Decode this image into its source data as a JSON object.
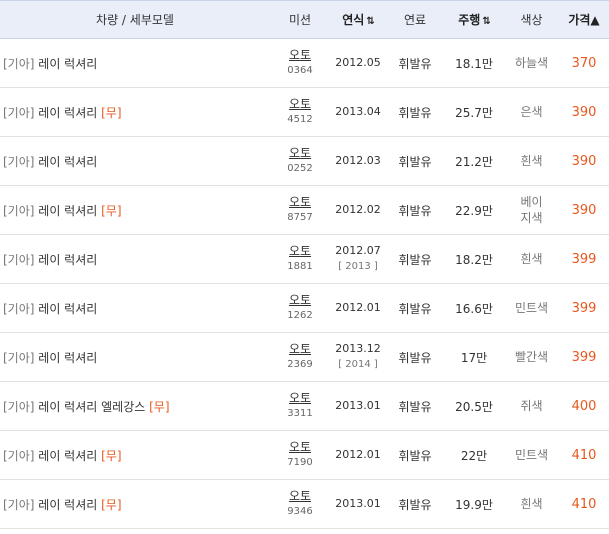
{
  "header": {
    "model": "차량 / 세부모델",
    "mission": "미션",
    "year": "연식",
    "fuel": "연료",
    "mileage": "주행",
    "color": "색상",
    "price": "가격▲",
    "sort_icon": "⇅"
  },
  "rows": [
    {
      "brand": "[기아]",
      "model": "레이 럭셔리",
      "badge": "",
      "mission": "오토",
      "code": "0364",
      "year": "2012.05",
      "year_sub": "",
      "fuel": "휘발유",
      "mileage": "18.1만",
      "color": "하늘색",
      "price": "370"
    },
    {
      "brand": "[기아]",
      "model": "레이 럭셔리",
      "badge": "[무]",
      "mission": "오토",
      "code": "4512",
      "year": "2013.04",
      "year_sub": "",
      "fuel": "휘발유",
      "mileage": "25.7만",
      "color": "은색",
      "price": "390"
    },
    {
      "brand": "[기아]",
      "model": "레이 럭셔리",
      "badge": "",
      "mission": "오토",
      "code": "0252",
      "year": "2012.03",
      "year_sub": "",
      "fuel": "휘발유",
      "mileage": "21.2만",
      "color": "흰색",
      "price": "390"
    },
    {
      "brand": "[기아]",
      "model": "레이 럭셔리",
      "badge": "[무]",
      "mission": "오토",
      "code": "8757",
      "year": "2012.02",
      "year_sub": "",
      "fuel": "휘발유",
      "mileage": "22.9만",
      "color": "베이\n지색",
      "price": "390"
    },
    {
      "brand": "[기아]",
      "model": "레이 럭셔리",
      "badge": "",
      "mission": "오토",
      "code": "1881",
      "year": "2012.07",
      "year_sub": "[ 2013 ]",
      "fuel": "휘발유",
      "mileage": "18.2만",
      "color": "흰색",
      "price": "399"
    },
    {
      "brand": "[기아]",
      "model": "레이 럭셔리",
      "badge": "",
      "mission": "오토",
      "code": "1262",
      "year": "2012.01",
      "year_sub": "",
      "fuel": "휘발유",
      "mileage": "16.6만",
      "color": "민트색",
      "price": "399"
    },
    {
      "brand": "[기아]",
      "model": "레이 럭셔리",
      "badge": "",
      "mission": "오토",
      "code": "2369",
      "year": "2013.12",
      "year_sub": "[ 2014 ]",
      "fuel": "휘발유",
      "mileage": "17만",
      "color": "빨간색",
      "price": "399"
    },
    {
      "brand": "[기아]",
      "model": "레이 럭셔리 엘레강스",
      "badge": "[무]",
      "mission": "오토",
      "code": "3311",
      "year": "2013.01",
      "year_sub": "",
      "fuel": "휘발유",
      "mileage": "20.5만",
      "color": "쥐색",
      "price": "400"
    },
    {
      "brand": "[기아]",
      "model": "레이 럭셔리",
      "badge": "[무]",
      "mission": "오토",
      "code": "7190",
      "year": "2012.01",
      "year_sub": "",
      "fuel": "휘발유",
      "mileage": "22만",
      "color": "민트색",
      "price": "410"
    },
    {
      "brand": "[기아]",
      "model": "레이 럭셔리",
      "badge": "[무]",
      "mission": "오토",
      "code": "9346",
      "year": "2013.01",
      "year_sub": "",
      "fuel": "휘발유",
      "mileage": "19.9만",
      "color": "흰색",
      "price": "410"
    }
  ]
}
